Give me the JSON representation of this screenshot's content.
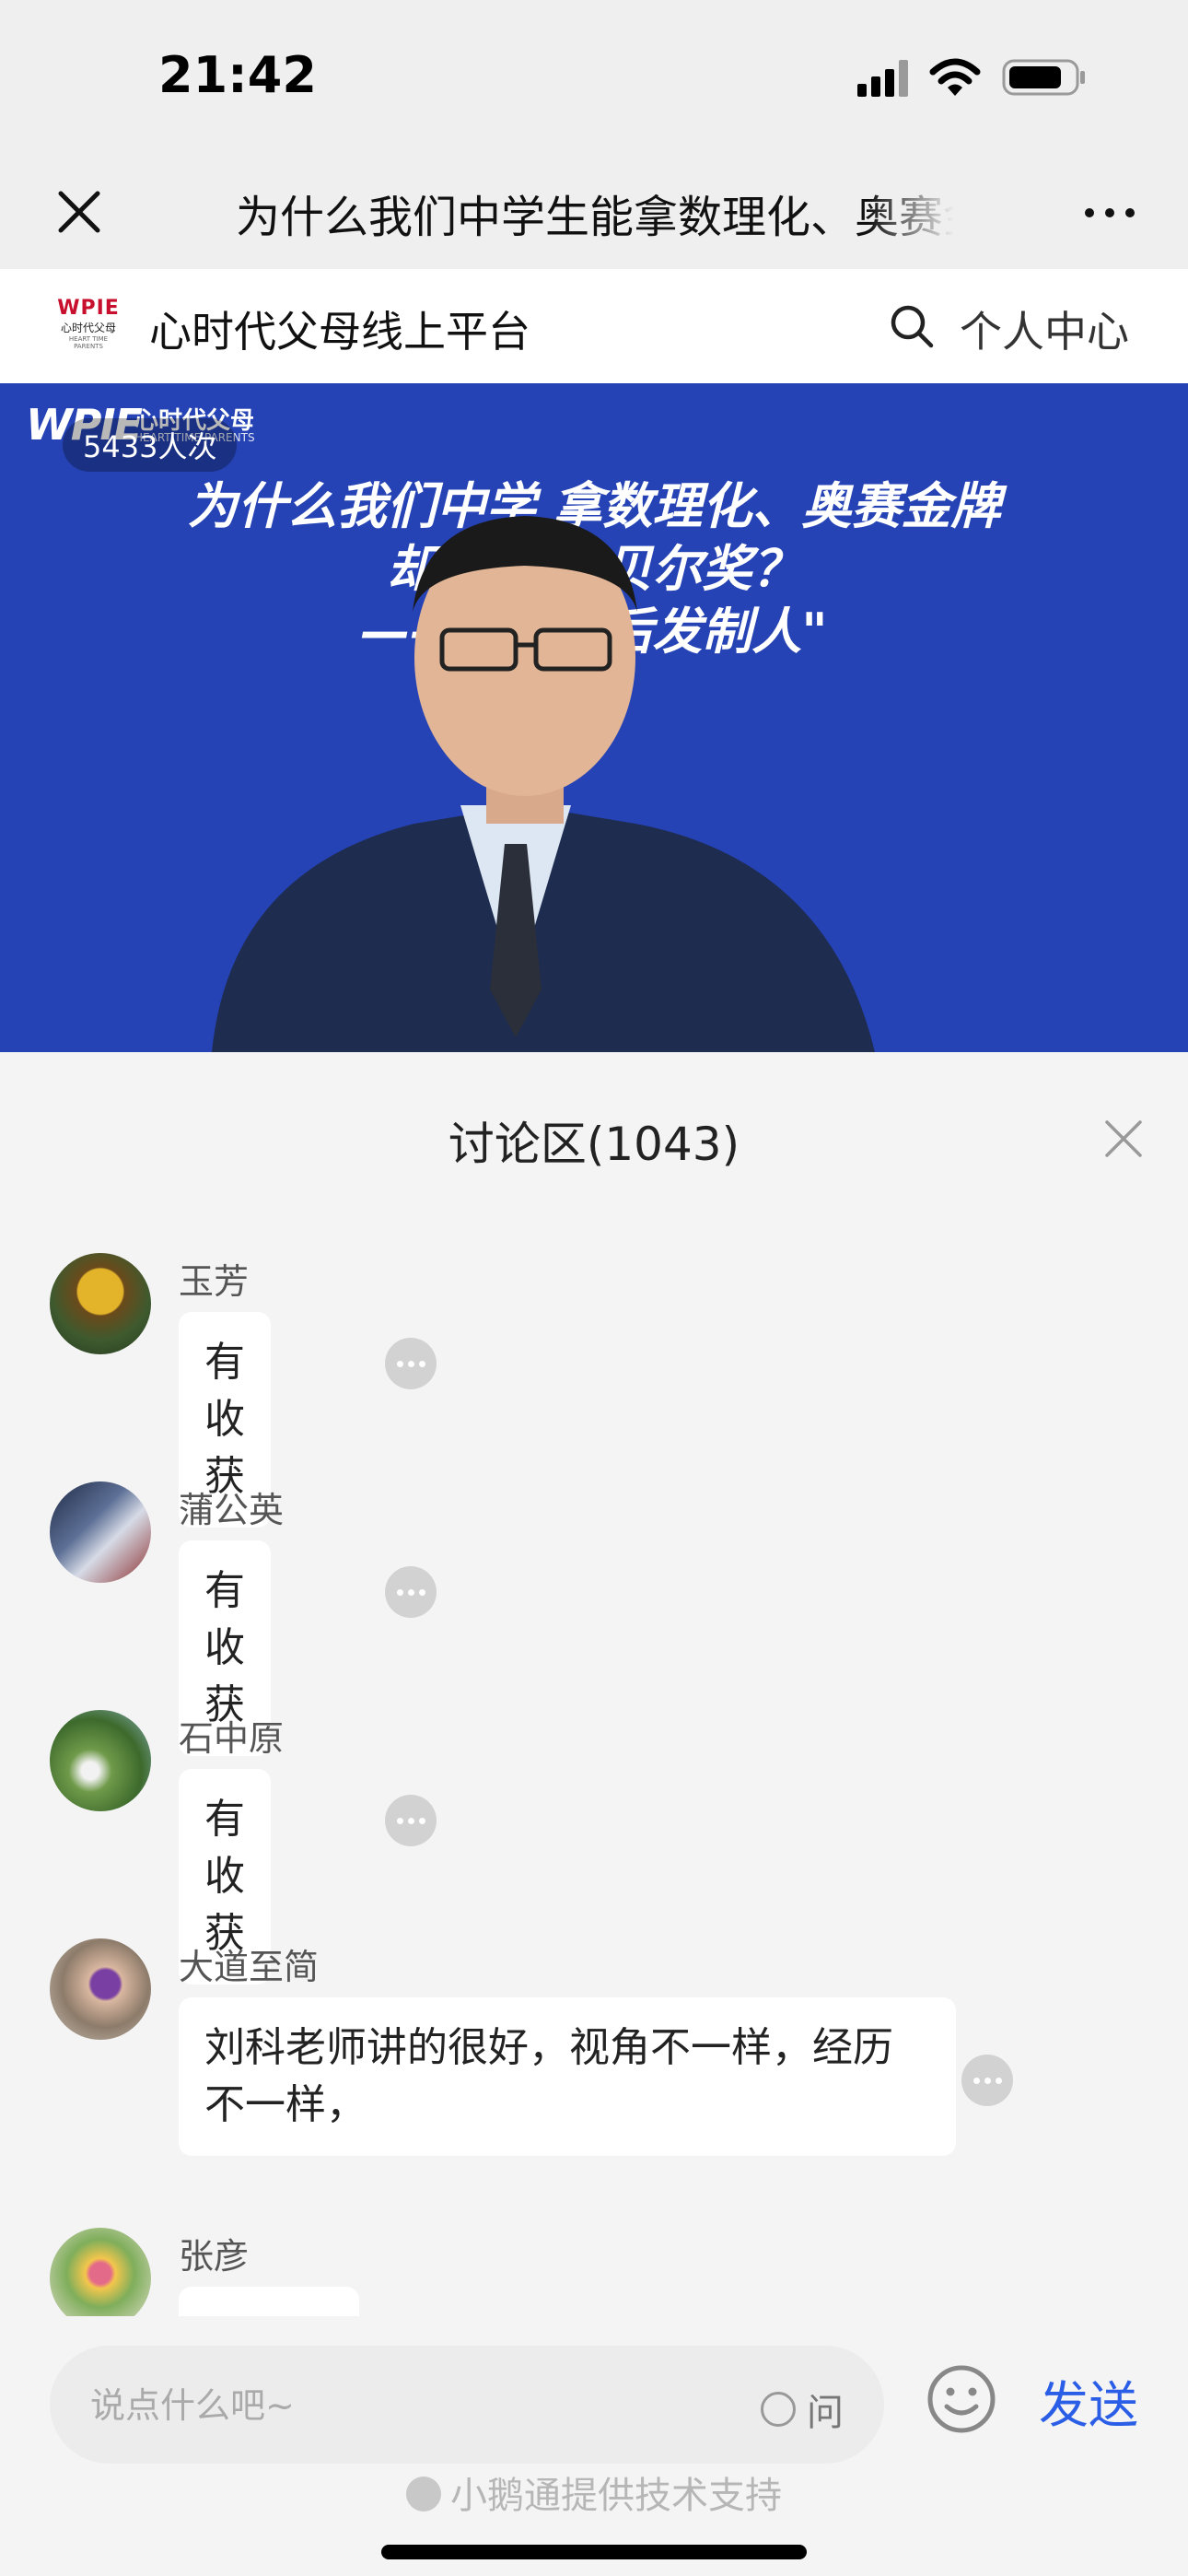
{
  "status_bar": {
    "time": "21:42"
  },
  "nav": {
    "title": "为什么我们中学生能拿数理化、奥赛金牌却出不了诺贝尔奖？——西方教育的\"后发制人\""
  },
  "site": {
    "logo_text": "WPIE",
    "logo_cn": "心时代父母",
    "logo_en": "HEART TIME PARENTS",
    "name": "心时代父母线上平台",
    "profile_label": "个人中心"
  },
  "video": {
    "brand": "WPIE",
    "brand_cn": "心时代父母",
    "brand_en": "HEART TIME PARENTS",
    "views": "5433人次",
    "title_line1": "为什么我们中学    拿数理化、奥赛金牌",
    "title_line2": "却出不    诺贝尔奖？",
    "title_line3": "——西方     \"后发制人\""
  },
  "discussion": {
    "title": "讨论区(1043)",
    "comments": [
      {
        "name": "玉芳",
        "text": "有收获"
      },
      {
        "name": "蒲公英",
        "text": "有收获"
      },
      {
        "name": "石中原",
        "text": "有收获"
      },
      {
        "name": "大道至简",
        "text": "刘科老师讲的很好，视角不一样，经历不一样，"
      },
      {
        "name": "张彦",
        "text": ""
      }
    ]
  },
  "composer": {
    "placeholder": "说点什么吧~",
    "ask_label": "问",
    "send_label": "发送"
  },
  "footer": {
    "powered_by": "小鹅通提供技术支持"
  },
  "colors": {
    "video_bg": "#2543b4",
    "send": "#2b5ee6",
    "brand_red": "#c8102e"
  }
}
